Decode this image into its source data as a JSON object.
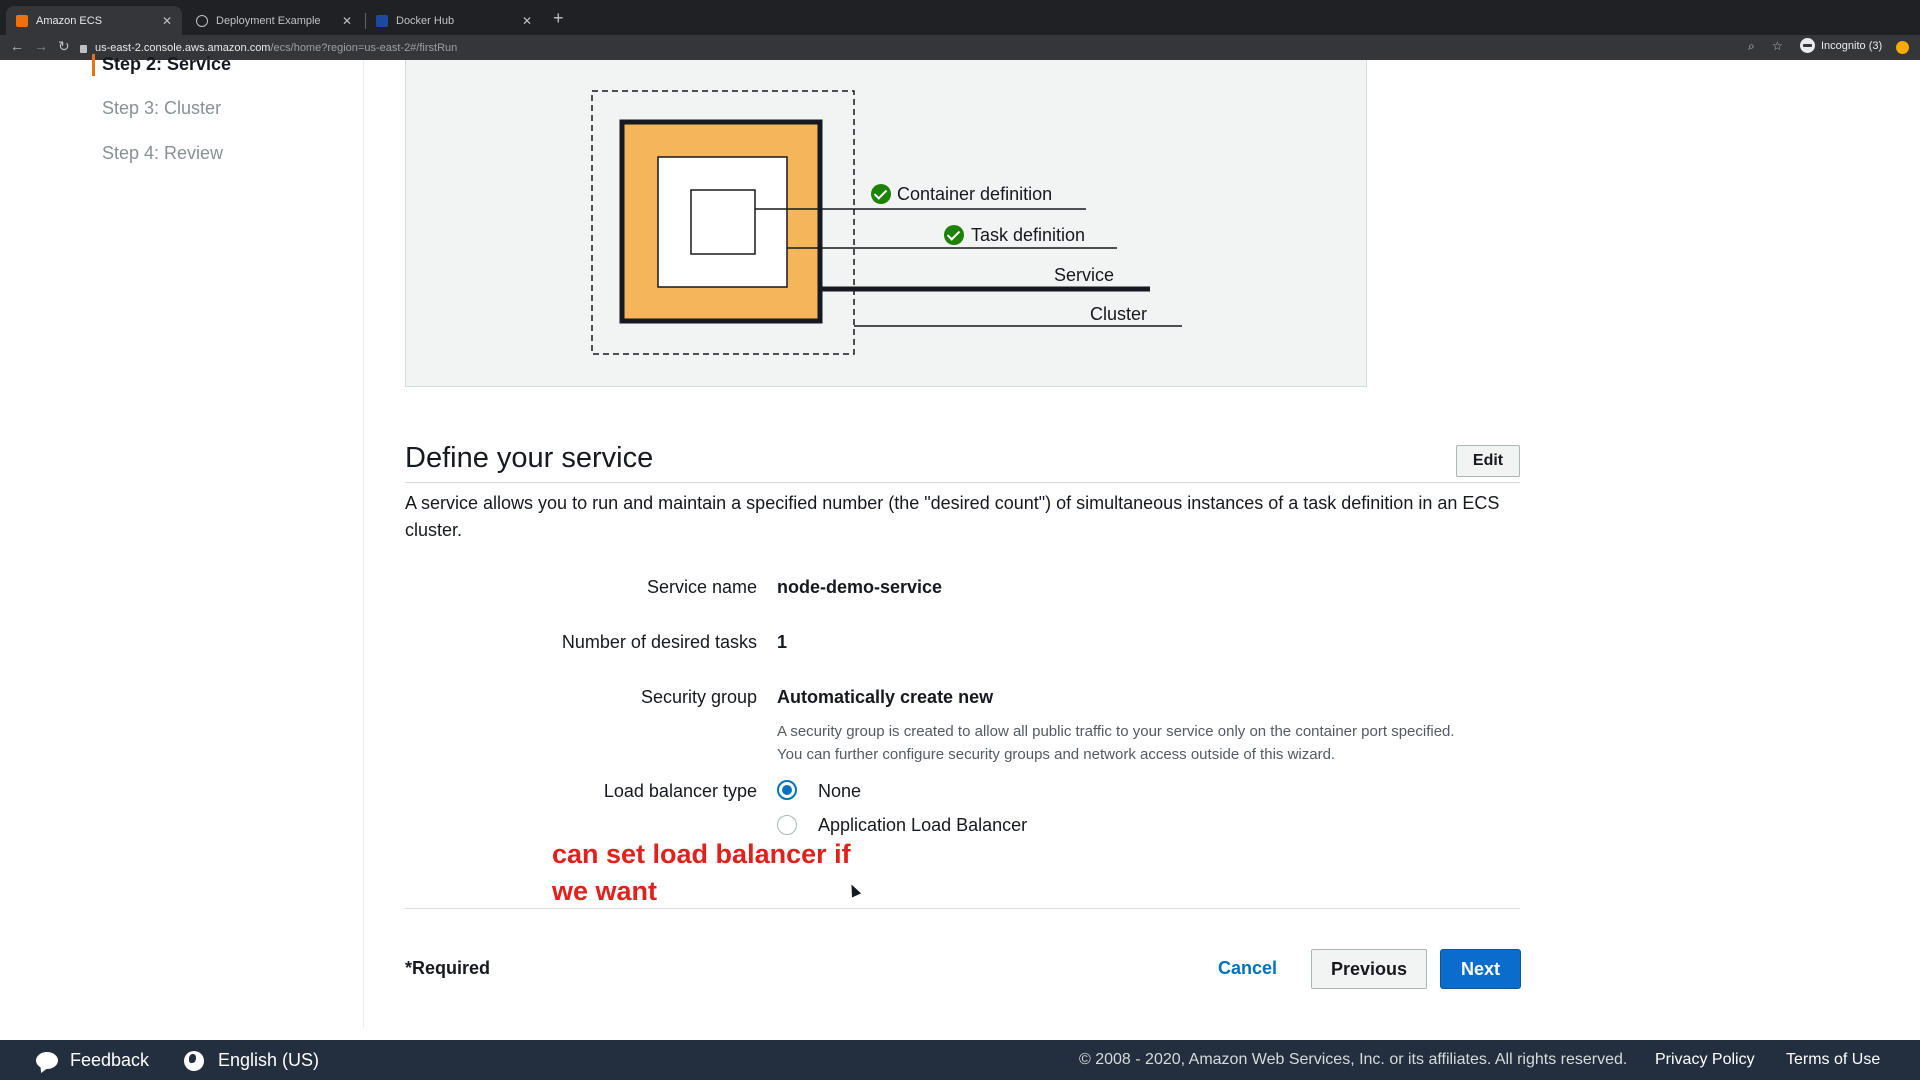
{
  "browser": {
    "tabs": [
      {
        "title": "Amazon ECS",
        "active": true
      },
      {
        "title": "Deployment Example",
        "active": false
      },
      {
        "title": "Docker Hub",
        "active": false
      }
    ],
    "url_host": "us-east-2.console.aws.amazon.com",
    "url_path": "/ecs/home?region=us-east-2#/firstRun",
    "profile_label": "Incognito (3)",
    "icons": [
      "back-icon",
      "forward-icon",
      "reload-icon",
      "lock-icon",
      "zoom-icon",
      "star-icon",
      "incognito-icon",
      "new-tab-icon"
    ]
  },
  "steps": [
    {
      "label": "Step 2: Service",
      "current": true
    },
    {
      "label": "Step 3: Cluster",
      "current": false
    },
    {
      "label": "Step 4: Review",
      "current": false
    }
  ],
  "diagram": {
    "container_definition": "Container definition",
    "task_definition": "Task definition",
    "service": "Service",
    "cluster": "Cluster",
    "accent_color": "#f4b55b"
  },
  "section": {
    "title": "Define your service",
    "edit_label": "Edit",
    "description": "A service allows you to run and maintain a specified number (the \"desired count\") of simultaneous instances of a task definition in an ECS cluster."
  },
  "fields": {
    "service_name_label": "Service name",
    "service_name_value": "node-demo-service",
    "desired_tasks_label": "Number of desired tasks",
    "desired_tasks_value": "1",
    "security_group_label": "Security group",
    "security_group_value": "Automatically create new",
    "security_group_help_1": "A security group is created to allow all public traffic to your service only on the container port specified.",
    "security_group_help_2": "You can further configure security groups and network access outside of this wizard.",
    "load_balancer_label": "Load balancer type",
    "load_balancer_options": [
      {
        "label": "None",
        "selected": true
      },
      {
        "label": "Application Load Balancer",
        "selected": false
      }
    ]
  },
  "annotation": {
    "line1": "can set load balancer if",
    "line2": "we want"
  },
  "actions": {
    "required_note": "*Required",
    "cancel": "Cancel",
    "previous": "Previous",
    "next": "Next",
    "primary_color": "#0a6ccc"
  },
  "footer": {
    "feedback": "Feedback",
    "language": "English (US)",
    "copyright": "© 2008 - 2020, Amazon Web Services, Inc. or its affiliates. All rights reserved.",
    "privacy": "Privacy Policy",
    "terms": "Terms of Use"
  }
}
